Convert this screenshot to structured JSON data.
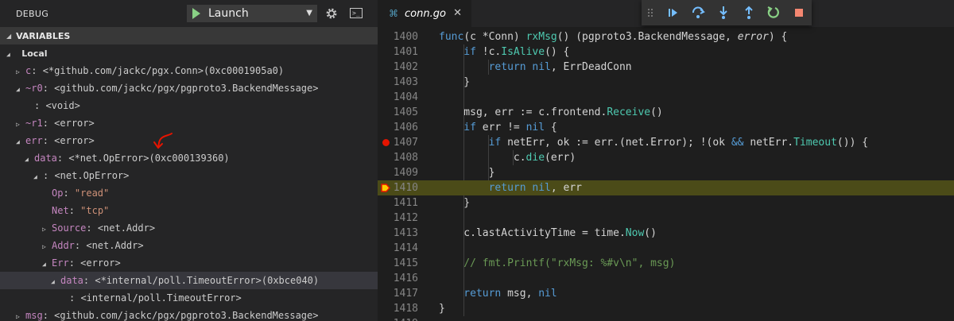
{
  "debug": {
    "title": "DEBUG",
    "launch_config": "Launch",
    "variables_header": "VARIABLES",
    "local_label": "Local"
  },
  "variables": [
    {
      "depth": 0,
      "twisty": "closed",
      "name": "c",
      "value": "<*github.com/jackc/pgx.Conn>(0xc0001905a0)"
    },
    {
      "depth": 0,
      "twisty": "open",
      "name": "~r0",
      "value": "<github.com/jackc/pgx/pgproto3.BackendMessage>"
    },
    {
      "depth": 1,
      "twisty": "none",
      "name": "",
      "value": "<void>"
    },
    {
      "depth": 0,
      "twisty": "closed",
      "name": "~r1",
      "value": "<error>"
    },
    {
      "depth": 0,
      "twisty": "open",
      "name": "err",
      "value": "<error>"
    },
    {
      "depth": 1,
      "twisty": "open",
      "name": "data",
      "value": "<*net.OpError>(0xc000139360)"
    },
    {
      "depth": 2,
      "twisty": "open",
      "name": "",
      "value": "<net.OpError>"
    },
    {
      "depth": 3,
      "twisty": "none",
      "name": "Op",
      "value": "\"read\"",
      "is_string": true
    },
    {
      "depth": 3,
      "twisty": "none",
      "name": "Net",
      "value": "\"tcp\"",
      "is_string": true
    },
    {
      "depth": 3,
      "twisty": "closed",
      "name": "Source",
      "value": "<net.Addr>"
    },
    {
      "depth": 3,
      "twisty": "closed",
      "name": "Addr",
      "value": "<net.Addr>"
    },
    {
      "depth": 3,
      "twisty": "open",
      "name": "Err",
      "value": "<error>"
    },
    {
      "depth": 4,
      "twisty": "open",
      "name": "data",
      "value": "<*internal/poll.TimeoutError>(0xbce040)",
      "selected": true
    },
    {
      "depth": 5,
      "twisty": "none",
      "name": "",
      "value": "<internal/poll.TimeoutError>"
    },
    {
      "depth": 0,
      "twisty": "closed",
      "name": "msg",
      "value": "<github.com/jackc/pgx/pgproto3.BackendMessage>"
    }
  ],
  "editor": {
    "tab_label": "conn.go",
    "breakpoint_line": 1407,
    "current_line": 1410,
    "code_lines": [
      {
        "n": 1400,
        "indent": 0,
        "tokens": [
          [
            "kw",
            "func"
          ],
          [
            "",
            "(c *Conn) "
          ],
          [
            "fn",
            "rxMsg"
          ],
          [
            "",
            "() (pgproto3.BackendMessage, "
          ],
          [
            "it",
            "error"
          ],
          [
            "",
            ") {"
          ]
        ]
      },
      {
        "n": 1401,
        "indent": 1,
        "tokens": [
          [
            "kw",
            "if"
          ],
          [
            "",
            " !c."
          ],
          [
            "fn",
            "IsAlive"
          ],
          [
            "",
            "() {"
          ]
        ]
      },
      {
        "n": 1402,
        "indent": 2,
        "tokens": [
          [
            "kw",
            "return"
          ],
          [
            "",
            " "
          ],
          [
            "kw",
            "nil"
          ],
          [
            "",
            ", ErrDeadConn"
          ]
        ]
      },
      {
        "n": 1403,
        "indent": 1,
        "tokens": [
          [
            "",
            "}"
          ]
        ]
      },
      {
        "n": 1404,
        "indent": 0,
        "tokens": []
      },
      {
        "n": 1405,
        "indent": 1,
        "tokens": [
          [
            "",
            "msg, err := c.frontend."
          ],
          [
            "fn",
            "Receive"
          ],
          [
            "",
            "()"
          ]
        ]
      },
      {
        "n": 1406,
        "indent": 1,
        "tokens": [
          [
            "kw",
            "if"
          ],
          [
            "",
            " err != "
          ],
          [
            "kw",
            "nil"
          ],
          [
            "",
            " {"
          ]
        ]
      },
      {
        "n": 1407,
        "indent": 2,
        "tokens": [
          [
            "kw",
            "if"
          ],
          [
            "",
            " netErr, ok := err.(net.Error); !(ok "
          ],
          [
            "kw",
            "&&"
          ],
          [
            "",
            " netErr."
          ],
          [
            "fn",
            "Timeout"
          ],
          [
            "",
            "()) {"
          ]
        ]
      },
      {
        "n": 1408,
        "indent": 3,
        "tokens": [
          [
            "",
            "c."
          ],
          [
            "fn",
            "die"
          ],
          [
            "",
            "(err)"
          ]
        ]
      },
      {
        "n": 1409,
        "indent": 2,
        "tokens": [
          [
            "",
            "}"
          ]
        ]
      },
      {
        "n": 1410,
        "indent": 2,
        "tokens": [
          [
            "kw",
            "return"
          ],
          [
            "",
            " "
          ],
          [
            "kw",
            "nil"
          ],
          [
            "",
            ", err"
          ]
        ]
      },
      {
        "n": 1411,
        "indent": 1,
        "tokens": [
          [
            "",
            "}"
          ]
        ]
      },
      {
        "n": 1412,
        "indent": 0,
        "tokens": []
      },
      {
        "n": 1413,
        "indent": 1,
        "tokens": [
          [
            "",
            "c.lastActivityTime = time."
          ],
          [
            "fn",
            "Now"
          ],
          [
            "",
            "()"
          ]
        ]
      },
      {
        "n": 1414,
        "indent": 0,
        "tokens": []
      },
      {
        "n": 1415,
        "indent": 1,
        "tokens": [
          [
            "cm",
            "// fmt.Printf(\"rxMsg: %#v\\n\", msg)"
          ]
        ]
      },
      {
        "n": 1416,
        "indent": 0,
        "tokens": []
      },
      {
        "n": 1417,
        "indent": 1,
        "tokens": [
          [
            "kw",
            "return"
          ],
          [
            "",
            " msg, "
          ],
          [
            "kw",
            "nil"
          ]
        ]
      },
      {
        "n": 1418,
        "indent": 0,
        "tokens": [
          [
            "",
            "}"
          ]
        ]
      },
      {
        "n": 1419,
        "indent": 0,
        "tokens": []
      }
    ]
  },
  "debug_toolbar_buttons": [
    "continue-icon",
    "step-over-icon",
    "step-into-icon",
    "step-out-icon",
    "restart-icon",
    "stop-icon"
  ],
  "colors": {
    "accent": "#3794ff",
    "breakpoint": "#e51400",
    "current_line": "#4b4b18",
    "restart": "#89d185",
    "stop": "#f48771",
    "annotation": "#e51400"
  }
}
